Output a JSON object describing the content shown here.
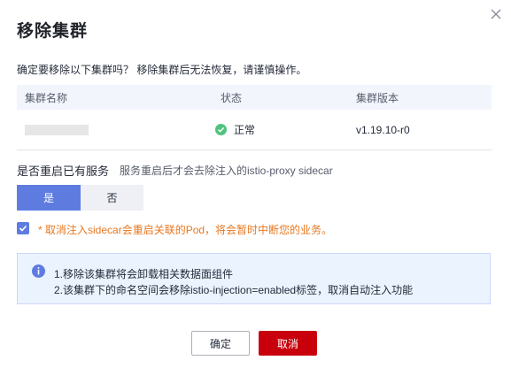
{
  "dialog": {
    "title": "移除集群",
    "confirm_text": "确定要移除以下集群吗？ 移除集群后无法恢复，请谨慎操作。"
  },
  "table": {
    "headers": [
      "集群名称",
      "状态",
      "集群版本"
    ],
    "rows": [
      {
        "name": "",
        "status": "正常",
        "version": "v1.19.10-r0"
      }
    ]
  },
  "restart": {
    "label": "是否重启已有服务",
    "hint": "服务重启后才会去除注入的istio-proxy sidecar",
    "options": [
      "是",
      "否"
    ],
    "selected": "是"
  },
  "warning": {
    "checked": true,
    "text": "* 取消注入sidecar会重启关联的Pod，将会暂时中断您的业务。"
  },
  "info": {
    "lines": [
      "1.移除该集群将会卸载相关数据面组件",
      "2.该集群下的命名空间会移除istio-injection=enabled标签，取消自动注入功能"
    ]
  },
  "buttons": {
    "ok": "确定",
    "cancel": "取消"
  },
  "colors": {
    "primary": "#5e7ce0",
    "danger": "#c7000b",
    "success": "#50c37f",
    "warning": "#e8771f"
  }
}
